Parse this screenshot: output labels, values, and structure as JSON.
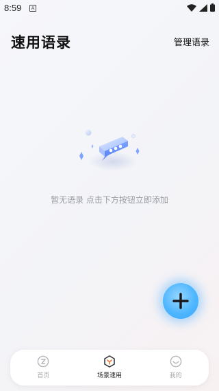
{
  "status": {
    "time": "8:59",
    "notification_glyph": "A"
  },
  "header": {
    "title": "速用语录",
    "manage_label": "管理语录"
  },
  "empty": {
    "message": "暂无语录 点击下方按钮立即添加"
  },
  "fab": {
    "icon": "plus-icon",
    "color": "#4fb7ff"
  },
  "nav": {
    "items": [
      {
        "label": "首页",
        "icon": "translate-icon",
        "active": false
      },
      {
        "label": "场景速用",
        "icon": "scene-icon",
        "active": true
      },
      {
        "label": "我的",
        "icon": "profile-icon",
        "active": false
      }
    ]
  }
}
